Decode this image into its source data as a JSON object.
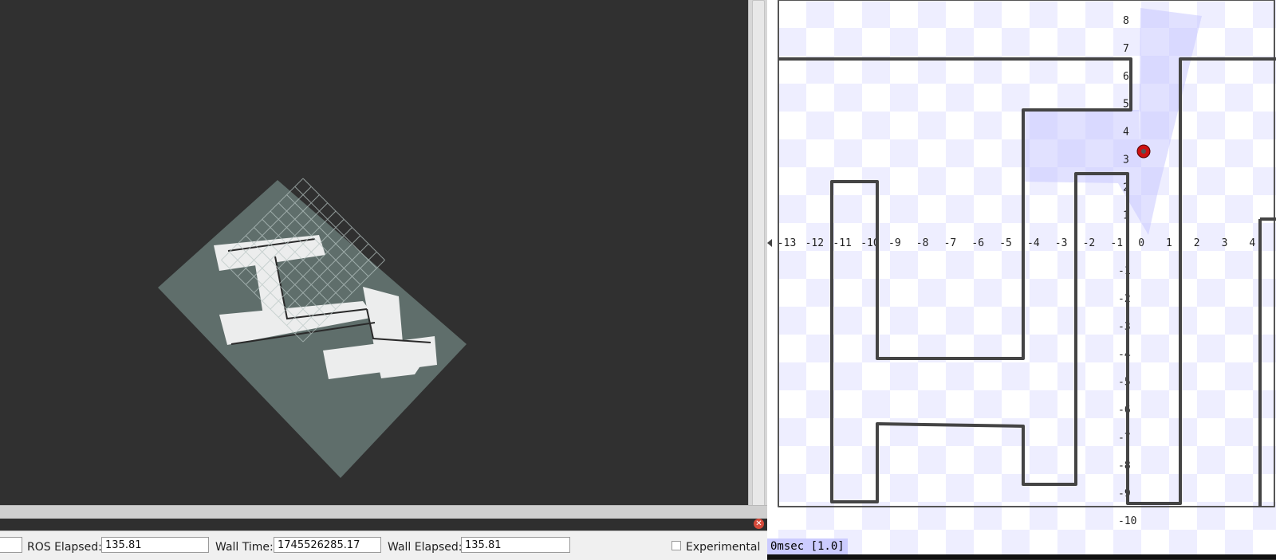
{
  "time_bar": {
    "ros_elapsed_label": "ROS Elapsed:",
    "ros_elapsed_value": "135.81",
    "wall_time_label": "Wall Time:",
    "wall_time_value": "1745526285.17",
    "wall_elapsed_label": "Wall Elapsed:",
    "wall_elapsed_value": "135.81",
    "experimental_label": "Experimental",
    "experimental_checked": false
  },
  "stage": {
    "status_text": "0msec [1.0]",
    "x_axis_labels": [
      "-4",
      "-13",
      "-12",
      "-11",
      "-10",
      "-9",
      "-8",
      "-7",
      "-6",
      "-5",
      "-4",
      "-3",
      "-2",
      "-1",
      "0",
      "1",
      "2",
      "3",
      "4"
    ],
    "y_axis_labels": [
      "8",
      "7",
      "6",
      "5",
      "4",
      "3",
      "2",
      "1",
      "-1",
      "-2",
      "-3",
      "-4",
      "-5",
      "-6",
      "-7",
      "-8",
      "-9",
      "-10"
    ],
    "robot_color": "#cc1111",
    "wall_color": "#444444",
    "laser_color": "#c8c8ff",
    "checker_color": "#eeeeff"
  },
  "rviz": {
    "background_color": "#303030",
    "map_color": "#5f6e6b"
  },
  "icons": {
    "close": "close-icon",
    "scroll_arrow": "scroll-left-arrow-icon"
  }
}
